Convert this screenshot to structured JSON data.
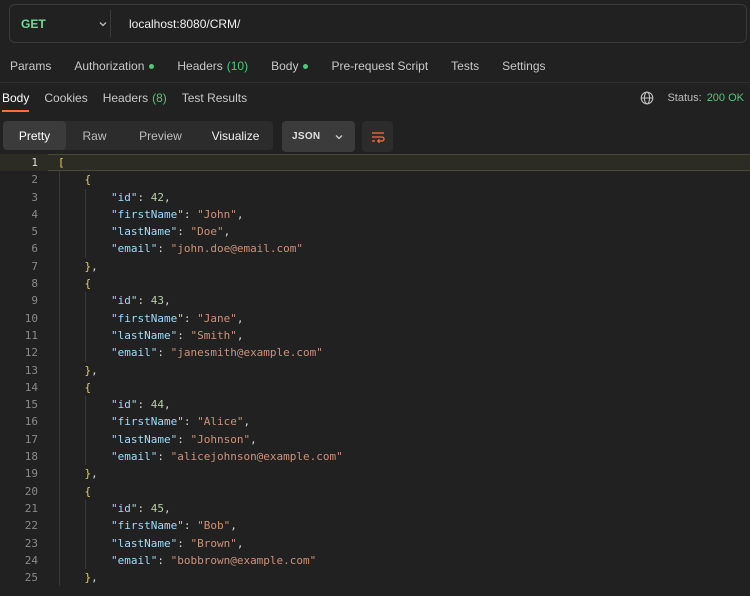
{
  "request": {
    "method": "GET",
    "url": "localhost:8080/CRM/"
  },
  "request_tabs": [
    {
      "label": "Params"
    },
    {
      "label": "Authorization",
      "dot": true
    },
    {
      "label": "Headers",
      "count": "(10)"
    },
    {
      "label": "Body",
      "dot": true
    },
    {
      "label": "Pre-request Script"
    },
    {
      "label": "Tests"
    },
    {
      "label": "Settings"
    }
  ],
  "response_tabs": [
    {
      "label": "Body",
      "active": true
    },
    {
      "label": "Cookies"
    },
    {
      "label": "Headers",
      "count": "(8)"
    },
    {
      "label": "Test Results"
    }
  ],
  "status": {
    "label": "Status:",
    "value": "200 OK"
  },
  "view_modes": {
    "pretty": "Pretty",
    "raw": "Raw",
    "preview": "Preview",
    "visualize": "Visualize",
    "selected": "Pretty"
  },
  "format": "JSON",
  "colors": {
    "method": "#6bdd9a",
    "status_ok": "#4fc979",
    "json_key": "#9cdcfe",
    "json_number": "#b5cea8",
    "json_string": "#ce9178",
    "bracket": "#e8d44d"
  },
  "records": [
    {
      "id": 42,
      "firstName": "John",
      "lastName": "Doe",
      "email": "john.doe@email.com"
    },
    {
      "id": 43,
      "firstName": "Jane",
      "lastName": "Smith",
      "email": "janesmith@example.com"
    },
    {
      "id": 44,
      "firstName": "Alice",
      "lastName": "Johnson",
      "email": "alicejohnson@example.com"
    },
    {
      "id": 45,
      "firstName": "Bob",
      "lastName": "Brown",
      "email": "bobbrown@example.com"
    }
  ],
  "active_line": 1
}
